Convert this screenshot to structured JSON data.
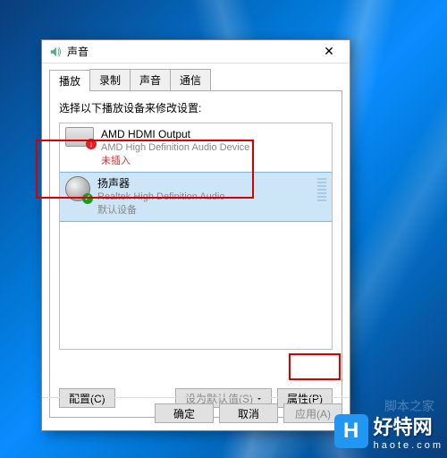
{
  "dialog": {
    "title": "声音",
    "close": "✕",
    "tabs": [
      "播放",
      "录制",
      "声音",
      "通信"
    ],
    "activeTab": 0,
    "instruction": "选择以下播放设备来修改设置:",
    "buttons": {
      "configure": "配置(C)",
      "setDefault": "设为默认值(S)",
      "properties": "属性(P)"
    },
    "dlgButtons": {
      "ok": "确定",
      "cancel": "取消",
      "apply": "应用(A)"
    }
  },
  "devices": [
    {
      "name": "AMD HDMI Output",
      "subtitle": "AMD High Definition Audio Device",
      "status": "未插入",
      "statusColor": "red",
      "icon": "monitor",
      "badge": "red",
      "selected": false
    },
    {
      "name": "扬声器",
      "subtitle": "Realtek High Definition Audio",
      "status": "默认设备",
      "statusColor": "gray",
      "icon": "speaker",
      "badge": "green",
      "selected": true
    }
  ],
  "logo": {
    "mark": "H",
    "text": "好特网",
    "sub": "haote.com"
  },
  "watermark": "脚本之家"
}
